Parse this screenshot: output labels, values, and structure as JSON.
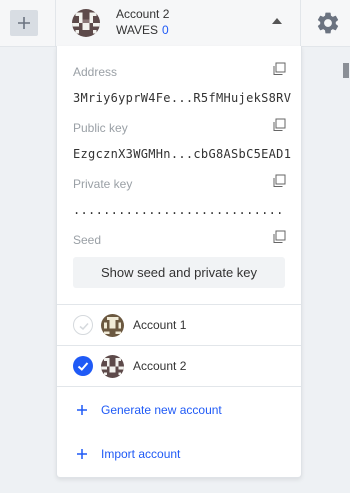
{
  "header": {
    "account_name": "Account 2",
    "currency": "WAVES",
    "balance": "0"
  },
  "panel": {
    "address_label": "Address",
    "address_value": "3Mriy6yprW4Fe...R5fMHujekS8RV",
    "public_key_label": "Public key",
    "public_key_value": "EzgcznX3WGMHn...cbG8ASbC5EAD1",
    "private_key_label": "Private key",
    "private_key_value": "............................",
    "seed_label": "Seed",
    "show_button": "Show seed and private key"
  },
  "accounts": [
    {
      "label": "Account 1",
      "selected": false
    },
    {
      "label": "Account 2",
      "selected": true
    }
  ],
  "actions": {
    "generate": "Generate new account",
    "import": "Import account"
  },
  "colors": {
    "accent": "#1f5af6",
    "label_gray": "#9aa0a6"
  }
}
